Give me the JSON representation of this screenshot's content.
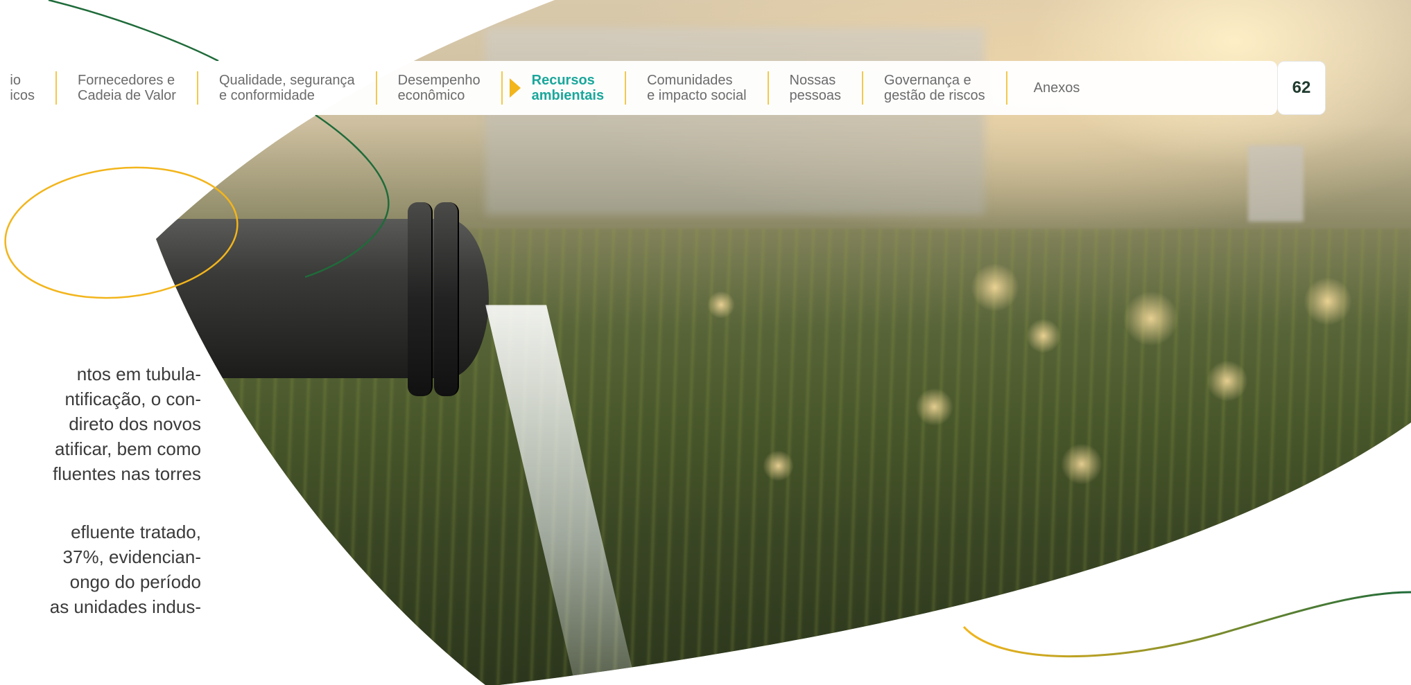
{
  "nav": {
    "items": [
      {
        "line1": "io",
        "line2": "icos"
      },
      {
        "line1": "Fornecedores e",
        "line2": "Cadeia de Valor"
      },
      {
        "line1": "Qualidade, segurança",
        "line2": "e conformidade"
      },
      {
        "line1": "Desempenho",
        "line2": "econômico"
      },
      {
        "line1": "Recursos",
        "line2": "ambientais"
      },
      {
        "line1": "Comunidades",
        "line2": "e impacto social"
      },
      {
        "line1": "Nossas",
        "line2": "pessoas"
      },
      {
        "line1": "Governança e",
        "line2": "gestão de riscos"
      },
      {
        "line1": "Anexos",
        "line2": ""
      }
    ],
    "active_index": 4,
    "page_number": "62"
  },
  "body": {
    "paragraph1": [
      "ntos em tubula-",
      "ntificação, o con-",
      "direto dos novos",
      "atificar, bem como",
      "fluentes nas torres"
    ],
    "paragraph2": [
      "efluente tratado,",
      "37%, evidencian-",
      "ongo do período",
      "as unidades indus-"
    ]
  },
  "colors": {
    "accent_teal": "#1aa79b",
    "accent_yellow": "#f2b51c",
    "divider": "#f2c94c",
    "curve_green": "#1f6b3a"
  }
}
